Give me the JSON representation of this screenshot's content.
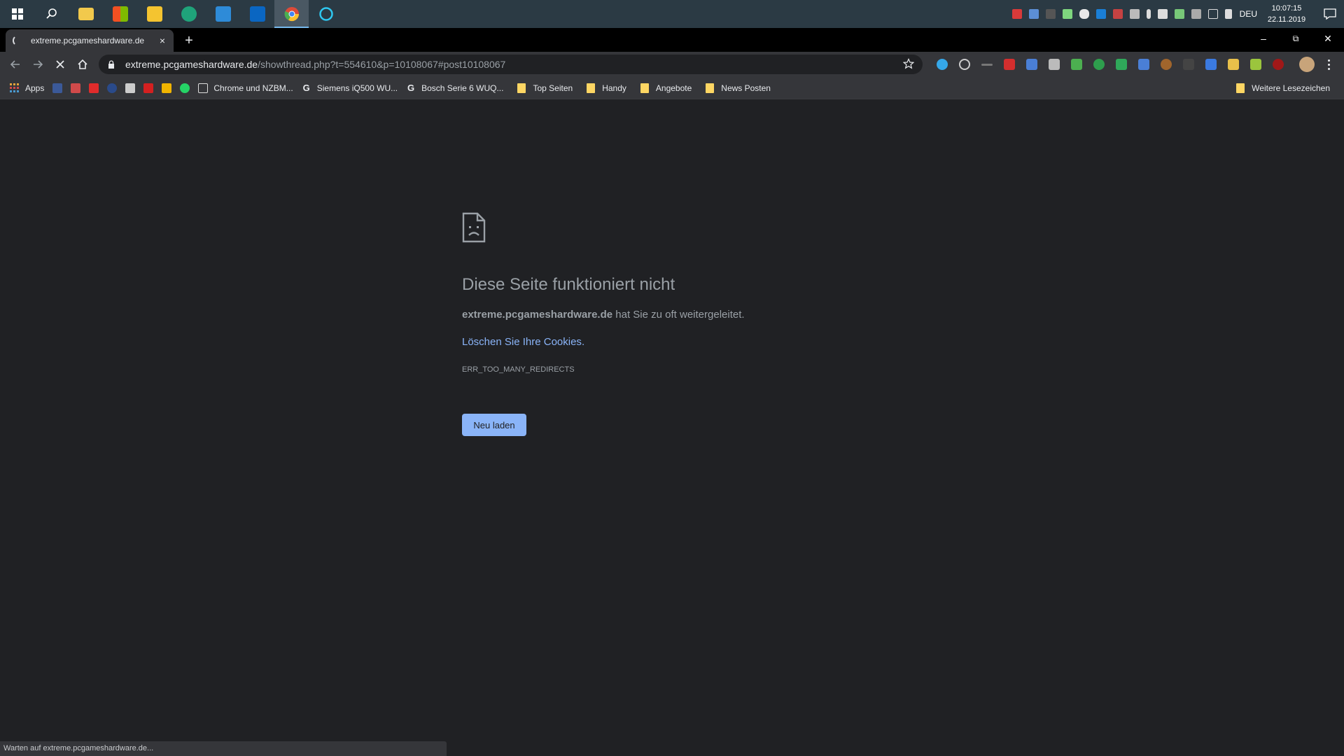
{
  "taskbar": {
    "apps": [
      {
        "name": "windows-start-icon",
        "color": "#ffffff"
      },
      {
        "name": "search-icon",
        "color": "#ffffff"
      },
      {
        "name": "file-explorer-icon",
        "color": "#f2c94c"
      },
      {
        "name": "store-icon",
        "color": "#ffffff"
      },
      {
        "name": "sabnzbd-icon",
        "color": "#f4c430"
      },
      {
        "name": "edge-dev-icon",
        "color": "#1fa37a"
      },
      {
        "name": "finder-icon",
        "color": "#2e8bd8"
      },
      {
        "name": "outlook-icon",
        "color": "#0a66c2"
      },
      {
        "name": "chrome-icon",
        "color": "#dd4b39",
        "active": true
      },
      {
        "name": "cortana-icon",
        "color": "#2ec7f0"
      }
    ],
    "language": "DEU",
    "time": "10:07:15",
    "date": "22.11.2019"
  },
  "tab": {
    "title": "extreme.pcgameshardware.de",
    "close_label": "×"
  },
  "new_tab_label": "+",
  "window_controls": {
    "minimize": "–",
    "restore": "⧉",
    "close": "✕"
  },
  "address_bar": {
    "host": "extreme.pcgameshardware.de",
    "path": "/showthread.php?t=554610&p=10108067#post10108067"
  },
  "bookmarks": {
    "apps_label": "Apps",
    "items": [
      {
        "label": "Chrome und NZBM...",
        "icon": "extension-icon"
      },
      {
        "label": "Siemens iQ500 WU...",
        "icon": "google-icon"
      },
      {
        "label": "Bosch Serie 6 WUQ...",
        "icon": "google-icon"
      }
    ],
    "folders": [
      "Top Seiten",
      "Handy",
      "Angebote",
      "News Posten"
    ],
    "more_label": "Weitere Lesezeichen"
  },
  "error": {
    "title": "Diese Seite funktioniert nicht",
    "host": "extreme.pcgameshardware.de",
    "description": "hat Sie zu oft weitergeleitet.",
    "link": "Löschen Sie Ihre Cookies",
    "link_suffix": ".",
    "code": "ERR_TOO_MANY_REDIRECTS",
    "reload_button": "Neu laden"
  },
  "status_bar": "Warten auf extreme.pcgameshardware.de..."
}
